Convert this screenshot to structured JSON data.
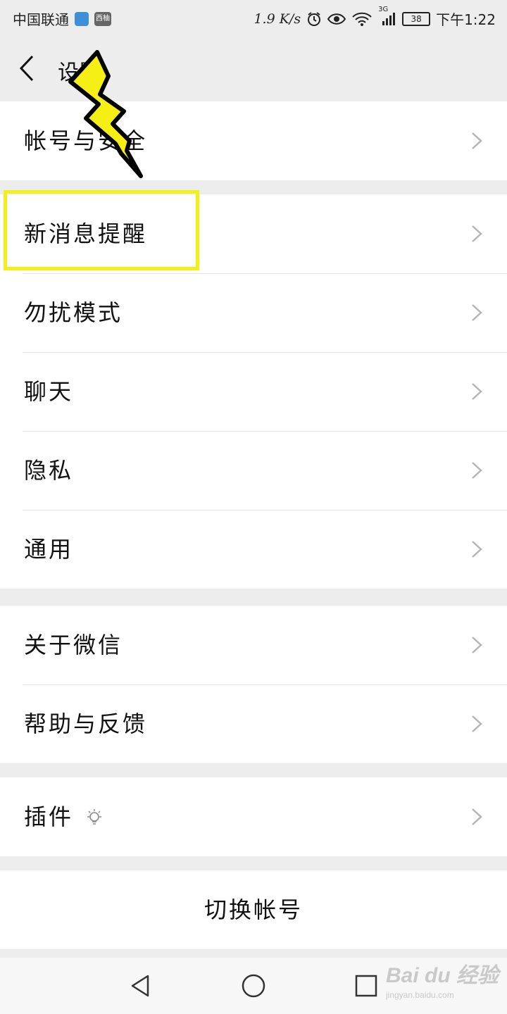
{
  "status_bar": {
    "carrier": "中国联通",
    "badge_label": "西柚",
    "net_speed": "1.9 K/s",
    "network_type": "3G",
    "battery": "38",
    "time": "下午1:22"
  },
  "top_bar": {
    "back_icon": "chevron-left-icon",
    "title": "设置"
  },
  "groups": [
    {
      "items": [
        {
          "label": "帐号与安全"
        }
      ]
    },
    {
      "items": [
        {
          "label": "新消息提醒"
        },
        {
          "label": "勿扰模式"
        },
        {
          "label": "聊天"
        },
        {
          "label": "隐私"
        },
        {
          "label": "通用"
        }
      ]
    },
    {
      "items": [
        {
          "label": "关于微信"
        },
        {
          "label": "帮助与反馈"
        }
      ]
    },
    {
      "items": [
        {
          "label": "插件",
          "icon": "lightbulb-icon"
        }
      ]
    }
  ],
  "switch_account": {
    "label": "切换帐号"
  },
  "nav_bar": {
    "back_icon": "triangle-back-icon",
    "home_icon": "circle-home-icon",
    "recents_icon": "square-recents-icon"
  },
  "annotation": {
    "highlight_color": "#f4ef14",
    "arrow": "lightning-bolt-arrow"
  },
  "watermark": {
    "brand": "Bai du 经验",
    "site": "jingyan.baidu.com"
  }
}
